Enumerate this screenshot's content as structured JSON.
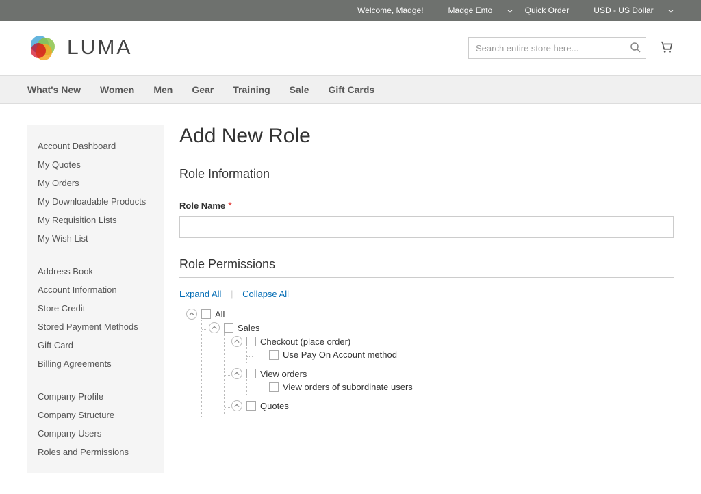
{
  "topbar": {
    "welcome": "Welcome, Madge!",
    "account_name": "Madge Ento",
    "quick_order": "Quick Order",
    "currency": "USD - US Dollar"
  },
  "logo_text": "LUMA",
  "search": {
    "placeholder": "Search entire store here..."
  },
  "nav": [
    "What's New",
    "Women",
    "Men",
    "Gear",
    "Training",
    "Sale",
    "Gift Cards"
  ],
  "sidebar": [
    "Account Dashboard",
    "My Quotes",
    "My Orders",
    "My Downloadable Products",
    "My Requisition Lists",
    "My Wish List",
    "---",
    "Address Book",
    "Account Information",
    "Store Credit",
    "Stored Payment Methods",
    "Gift Card",
    "Billing Agreements",
    "---",
    "Company Profile",
    "Company Structure",
    "Company Users",
    "Roles and Permissions"
  ],
  "page": {
    "title": "Add New Role",
    "section_info": "Role Information",
    "role_name_label": "Role Name",
    "role_name_value": "",
    "section_perms": "Role Permissions",
    "expand_all": "Expand All",
    "collapse_all": "Collapse All"
  },
  "tree": {
    "all": "All",
    "sales": "Sales",
    "checkout": "Checkout (place order)",
    "pay_on_account": "Use Pay On Account method",
    "view_orders": "View orders",
    "view_subordinate": "View orders of subordinate users",
    "quotes": "Quotes"
  }
}
